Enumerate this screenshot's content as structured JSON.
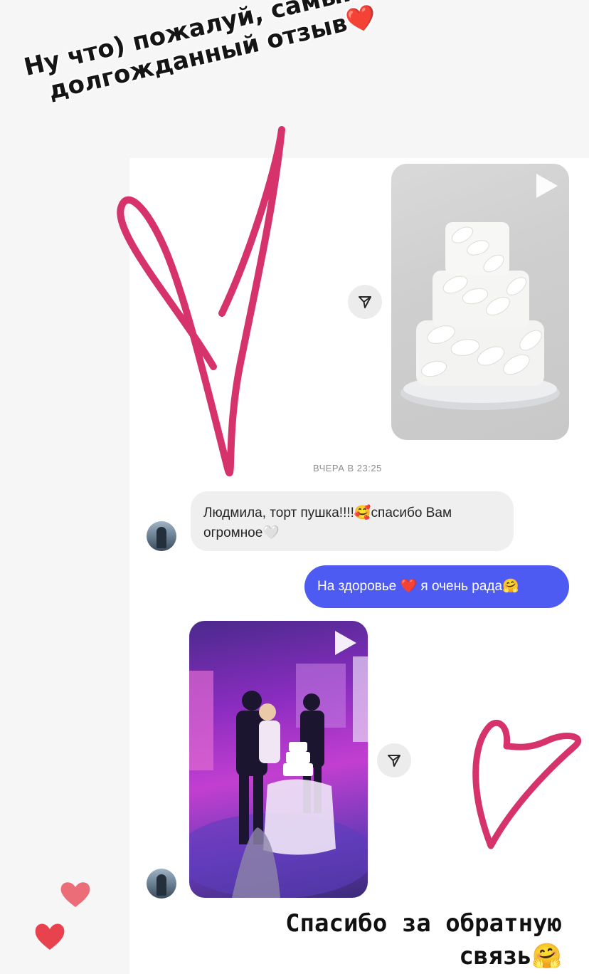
{
  "story": {
    "caption_top_line1": "Ну что) пожалуй, самый",
    "caption_top_line2": "долгожданный отзыв❤️",
    "caption_bottom_line1": "Спасибо за обратную",
    "caption_bottom_line2": "связь🤗"
  },
  "chat": {
    "timestamp": "ВЧЕРА В 23:25",
    "incoming_message": "Людмила, торт пушка!!!!🥰спасибо Вам огромное🤍",
    "outgoing_message": "На здоровье ❤️ я очень рада🤗"
  },
  "icons": {
    "share": "paper-plane-icon",
    "play": "play-icon",
    "heart": "heart-icon"
  },
  "colors": {
    "outgoing_bubble": "#4e5bf3",
    "incoming_bubble": "#efefef",
    "doodle_heart": "#d6336c",
    "heart_sticker": "#ea4a5a"
  }
}
